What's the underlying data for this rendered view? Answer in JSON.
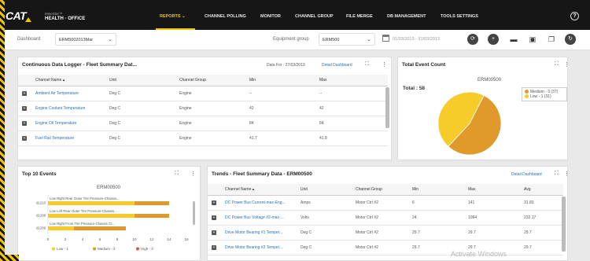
{
  "brand": {
    "logo": "CAT",
    "product_line1": "MineStar™",
    "product_line2": "HEALTH · OFFICE"
  },
  "nav": {
    "items": [
      "REPORTS",
      "CHANNEL POLLING",
      "MONITOR",
      "CHANNEL GROUP",
      "FILE MERGE",
      "DB MANAGEMENT",
      "TOOLS SETTINGS"
    ],
    "active": "REPORTS",
    "help": "?"
  },
  "filters": {
    "dashboard_label": "Dashboard",
    "dashboard_value": "ERM5002013Mar",
    "equipment_group_label": "Equipment group",
    "equipment_group_value": "ERM500",
    "date_range": "01/03/2013 - 31/03/2013"
  },
  "logger_panel": {
    "title": "Continuous Data Logger - Fleet Summary Dat...",
    "data_for": "Data For : 27/03/2013",
    "link": "Detail Dashboard",
    "columns": [
      "Channel Name",
      "Unit",
      "Channel Group",
      "Min",
      "Max"
    ],
    "rows": [
      [
        "Ambient Air Temperature",
        "Deg C",
        "Engine",
        "--",
        "--"
      ],
      [
        "Engine Coolant Temperature",
        "Deg C",
        "Engine",
        "42",
        "42"
      ],
      [
        "Engine Oil Temperature",
        "Deg C",
        "Engine",
        "84",
        "84"
      ],
      [
        "Fuel Rail Temperature",
        "Deg C",
        "Engine",
        "41.7",
        "41.8"
      ]
    ]
  },
  "event_count_panel": {
    "title": "Total Event Count",
    "chart_data": {
      "type": "pie",
      "title": "ERM00500",
      "total_label": "Total : 58",
      "categories": [
        "Medium - 3 (37)",
        "Low - 1 (31)"
      ],
      "values": [
        37,
        31
      ],
      "colors": [
        "#e09a2c",
        "#f7cc2a"
      ]
    }
  },
  "top_events_panel": {
    "title": "Top 10 Events",
    "chart_data": {
      "type": "bar",
      "title": "ERM00500",
      "categories": [
        "Low Right Rear Outer Tire Pressure-Chassis...",
        "Low Left Rear Outer Tire Pressure-Chassis...",
        "Low Right Front Tire Pressure-Chassis Ct..."
      ],
      "y_codes": [
        "d1210",
        "d1208",
        "d1209"
      ],
      "series": [
        {
          "name": "Low - 1",
          "values": [
            10,
            10,
            3
          ]
        },
        {
          "name": "Medium - 2",
          "values": [
            4,
            4,
            6
          ]
        },
        {
          "name": "High - 3",
          "values": [
            0,
            0,
            0
          ]
        }
      ],
      "xlim": [
        0,
        16
      ],
      "xticks": [
        "0",
        "2",
        "4",
        "6",
        "8",
        "10",
        "12",
        "14",
        "16"
      ],
      "legend": [
        "Low - 1",
        "Medium - 2",
        "High - 3"
      ],
      "colors": [
        "#f7cc2a",
        "#e09a2c",
        "#d9534f"
      ]
    }
  },
  "trends_panel": {
    "title": "Trends - Fleet Summary Data - ERM00500",
    "link": "Detail Dashboard",
    "columns": [
      "Channel Name",
      "Unit",
      "Channel Group",
      "Min",
      "Max",
      "Avg"
    ],
    "rows": [
      [
        "DC Power Bus Current-max-Eng...",
        "Amps",
        "Motor Ctrl #2",
        "6",
        "141",
        "31.83"
      ],
      [
        "DC Power Bus Voltage #2-max-...",
        "Volts",
        "Motor Ctrl #2",
        "24",
        "1084",
        "232.17"
      ],
      [
        "Drive Motor Bearing #1 Temper...",
        "Deg C",
        "Motor Ctrl #2",
        "29.7",
        "29.7",
        "29.7"
      ],
      [
        "Drive Motor Bearing #2 Temper...",
        "Deg C",
        "Motor Ctrl #2",
        "29.7",
        "29.7",
        "29.7"
      ]
    ]
  },
  "watermark": "Activate Windows"
}
